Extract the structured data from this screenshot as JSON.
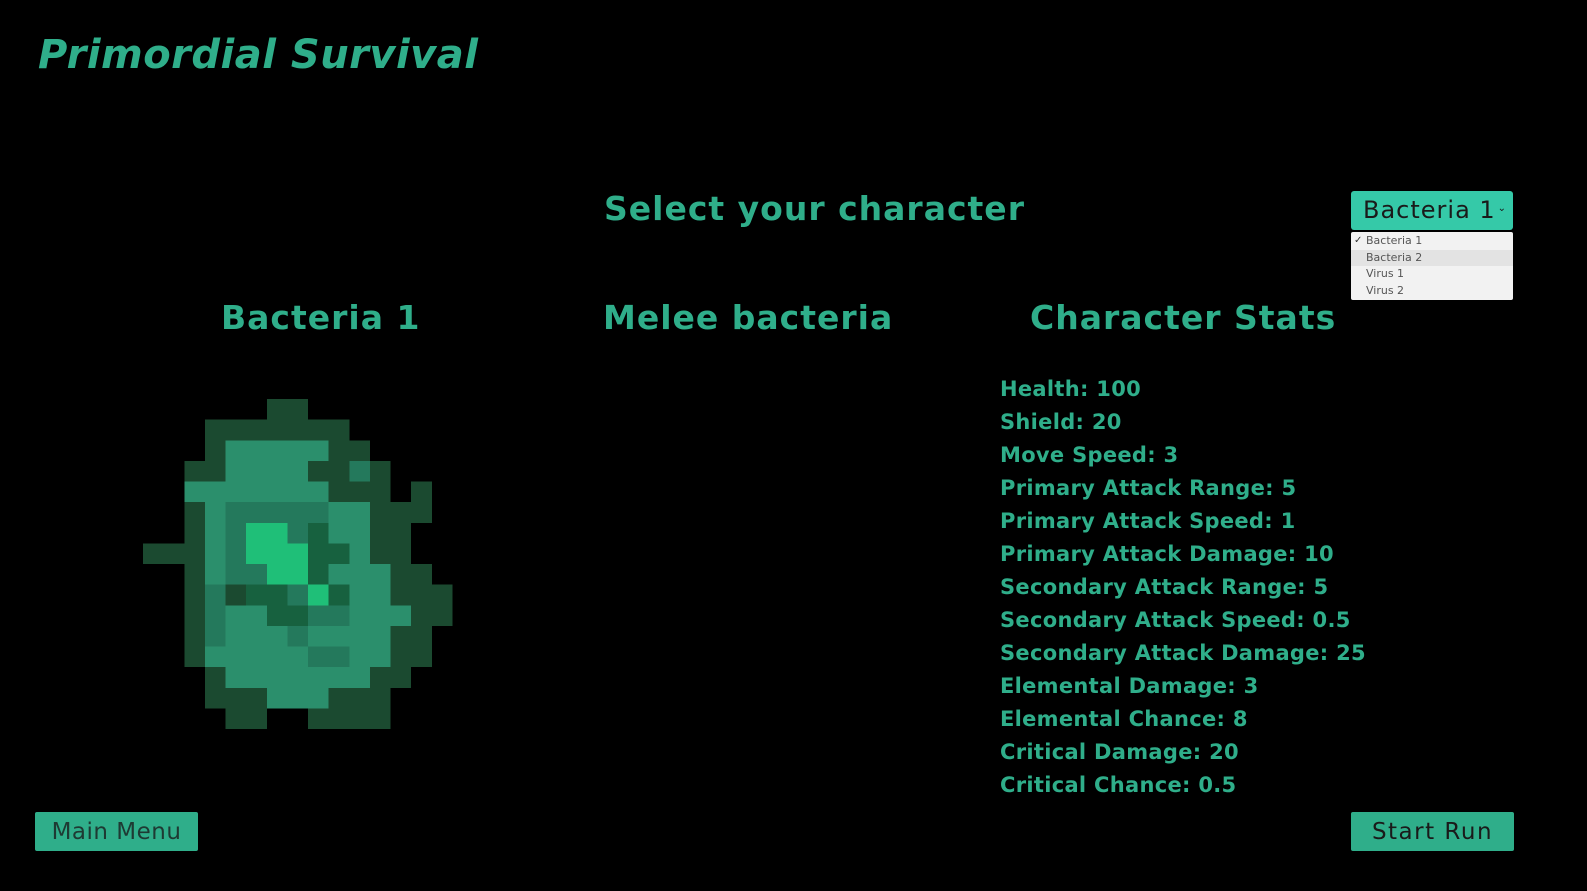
{
  "game_title": "Primordial Survival",
  "select_heading": "Select your character",
  "character": {
    "name": "Bacteria 1",
    "class": "Melee bacteria",
    "sprite_icon": "bacteria-sprite"
  },
  "stats": {
    "heading": "Character Stats",
    "items": [
      "Health: 100",
      "Shield: 20",
      "Move Speed: 3",
      "Primary Attack Range: 5",
      "Primary Attack Speed: 1",
      "Primary Attack Damage: 10",
      "Secondary Attack Range: 5",
      "Secondary Attack Speed: 0.5",
      "Secondary Attack Damage: 25",
      "Elemental Damage: 3",
      "Elemental Chance: 8",
      "Critical Damage: 20",
      "Critical Chance: 0.5"
    ]
  },
  "dropdown": {
    "selected": "Bacteria 1",
    "options": [
      "Bacteria 1",
      "Bacteria 2",
      "Virus 1",
      "Virus 2"
    ],
    "checked_index": 0,
    "hover_index": 1
  },
  "buttons": {
    "main_menu": "Main Menu",
    "start_run": "Start Run"
  },
  "colors": {
    "background": "#000000",
    "accent": "#2fae8a",
    "dropdown_bg": "#35c9a8"
  }
}
